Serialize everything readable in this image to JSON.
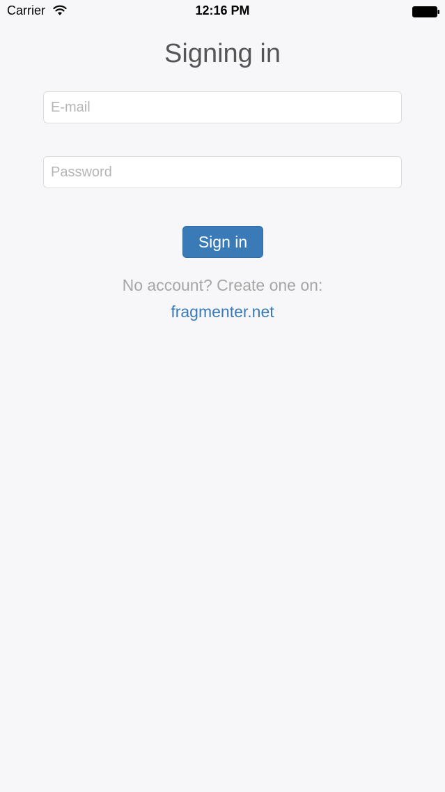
{
  "status_bar": {
    "carrier": "Carrier",
    "time": "12:16 PM",
    "wifi_icon": "wifi-icon",
    "battery_icon": "battery-icon"
  },
  "page": {
    "title": "Signing in"
  },
  "form": {
    "email_placeholder": "E-mail",
    "email_value": "",
    "password_placeholder": "Password",
    "password_value": "",
    "submit_label": "Sign in"
  },
  "footer": {
    "no_account_text": "No account? Create one on:",
    "link_text": "fragmenter.net"
  },
  "colors": {
    "accent": "#3a7ab7",
    "background": "#f7f7f9"
  }
}
